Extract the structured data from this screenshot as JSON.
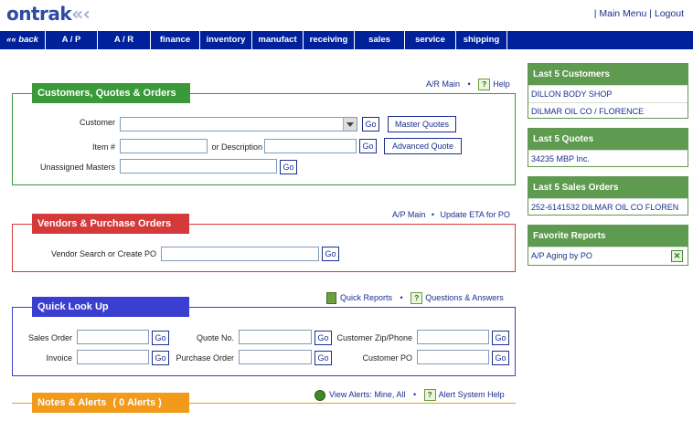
{
  "brand": {
    "logo_text": "ontrak",
    "logo_arrows": "«‹"
  },
  "topmenu": {
    "main_menu": "| Main Menu",
    "logout": "| Logout"
  },
  "nav": [
    "«« back",
    "A / P",
    "A / R",
    "finance",
    "inventory",
    "manufact",
    "receiving",
    "sales",
    "service",
    "shipping"
  ],
  "customers": {
    "title": "Customers, Quotes & Orders",
    "ar_main": "A/R Main",
    "help": "Help",
    "customer_label": "Customer",
    "item_label": "Item #",
    "or_desc_label": "or Description",
    "unassigned_label": "Unassigned Masters",
    "go": "Go",
    "master_quotes": "Master Quotes",
    "advanced_quote": "Advanced Quote"
  },
  "vendors": {
    "title": "Vendors & Purchase Orders",
    "ap_main": "A/P Main",
    "update_eta": "Update ETA for PO",
    "search_label": "Vendor Search or Create PO",
    "go": "Go"
  },
  "lookup": {
    "title": "Quick Look Up",
    "quick_reports": "Quick Reports",
    "qa": "Questions & Answers",
    "sales_order": "Sales Order",
    "invoice": "Invoice",
    "quote_no": "Quote No.",
    "purchase_order": "Purchase Order",
    "customer_zip": "Customer Zip/Phone",
    "customer_po": "Customer PO",
    "go": "Go"
  },
  "notes": {
    "title": "Notes & Alerts",
    "count": "( 0 Alerts )",
    "view_alerts": "View Alerts:",
    "mine": "Mine,",
    "all": "All",
    "alert_help": "Alert System Help"
  },
  "right": {
    "customers_title": "Last 5 Customers",
    "customers": [
      "DILLON BODY SHOP",
      "DILMAR OIL CO / FLORENCE"
    ],
    "quotes_title": "Last 5 Quotes",
    "quotes": [
      "34235 MBP Inc."
    ],
    "orders_title": "Last 5 Sales Orders",
    "orders": [
      "252-6141532 DILMAR OIL CO FLOREN"
    ],
    "reports_title": "Favorite Reports",
    "reports": [
      "A/P Aging by PO"
    ]
  },
  "colors": {
    "nav": "#00219a",
    "green": "#3a9a3a",
    "red": "#d43a3a",
    "blue": "#3b3fd0",
    "orange": "#f29a1a",
    "right_green": "#5e9a4f"
  }
}
